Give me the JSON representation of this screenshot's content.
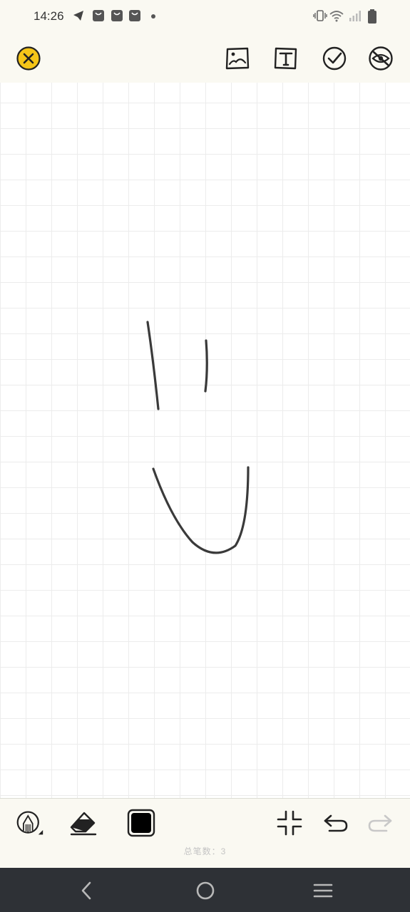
{
  "status_bar": {
    "time": "14:26",
    "left_icons": [
      "telegram-icon",
      "shopping-bag-icon",
      "shopping-bag-icon",
      "shopping-bag-icon",
      "dot-icon"
    ],
    "right_icons": [
      "vibrate-icon",
      "wifi-icon",
      "signal-icon",
      "battery-icon"
    ]
  },
  "toolbar": {
    "close_icon": "close-icon",
    "tools": [
      "image-icon",
      "text-icon",
      "check-icon",
      "hide-icon"
    ]
  },
  "canvas": {
    "background": "grid"
  },
  "bottom_toolbar": {
    "tools": [
      "pencil-icon",
      "eraser-icon",
      "color-swatch"
    ],
    "color": "#000000",
    "actions": [
      "shrink-icon",
      "undo-icon",
      "redo-icon"
    ],
    "stroke_count_text": "总笔数：3"
  },
  "nav_bar": {
    "buttons": [
      "back-icon",
      "home-icon",
      "recents-icon"
    ]
  },
  "colors": {
    "accent": "#f5c518",
    "bar_background": "#faf9f2",
    "nav_background": "#2e3136"
  }
}
